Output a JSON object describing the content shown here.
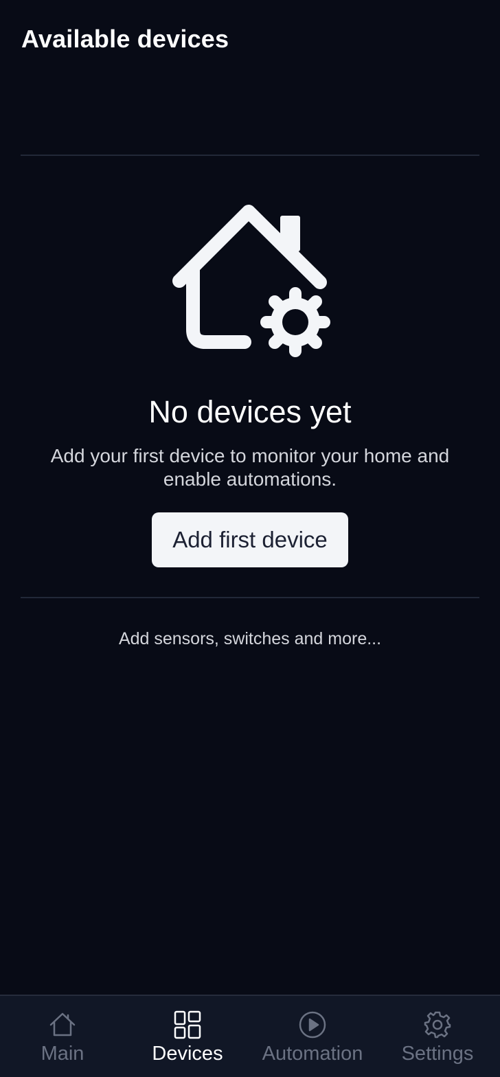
{
  "header": {
    "title": "Available devices"
  },
  "empty_state": {
    "icon": "home-gear-icon",
    "title": "No devices yet",
    "description": "Add your first device to monitor your home and enable automations.",
    "button_label": "Add first device",
    "hint": "Add sensors, switches and more..."
  },
  "tabbar": {
    "active": "Devices",
    "tabs": [
      {
        "label": "Main",
        "icon": "home-icon"
      },
      {
        "label": "Devices",
        "icon": "grid-icon"
      },
      {
        "label": "Automation",
        "icon": "play-circle-icon"
      },
      {
        "label": "Settings",
        "icon": "gear-icon"
      }
    ]
  },
  "colors": {
    "background": "#080b16",
    "tabbar_background": "#111726",
    "button_background": "#f3f5f8",
    "inactive_tab": "#6b7283",
    "active_tab": "#ffffff"
  }
}
